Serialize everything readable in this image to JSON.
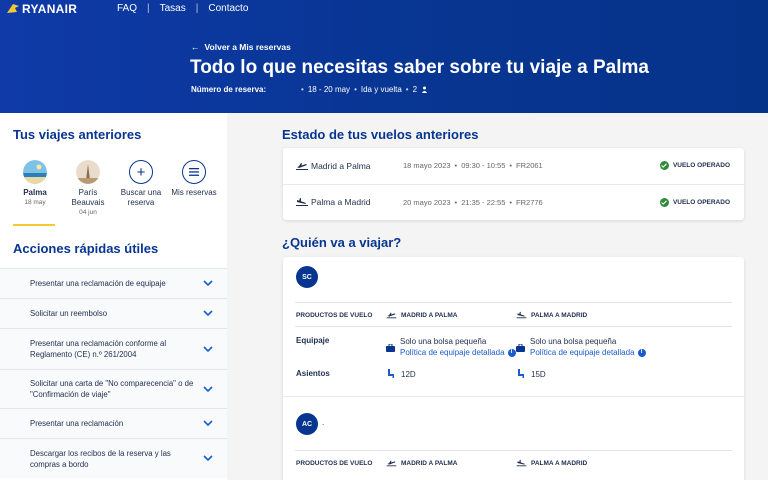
{
  "brand": {
    "name": "RYANAIR",
    "accent": "#073590",
    "yellow": "#f1c933"
  },
  "topnav": {
    "faq": "FAQ",
    "rates": "Tasas",
    "contact": "Contacto"
  },
  "hero": {
    "back_link": "Volver a Mis reservas",
    "title": "Todo lo que necesitas saber sobre tu viaje a Palma",
    "booking_label": "Número de reserva:",
    "dates": "18 - 20 may",
    "trip_type": "Ida y vuelta",
    "passengers": "2"
  },
  "sidebar": {
    "past_trips_title": "Tus viajes anteriores",
    "trips": [
      {
        "name": "Palma",
        "date": "18 may"
      },
      {
        "name": "París Beauvais",
        "date": "04 jun"
      }
    ],
    "search_trip": "Buscar una reserva",
    "my_bookings": "Mis reservas",
    "quick_actions_title": "Acciones rápidas útiles",
    "actions": [
      "Presentar una reclamación de equipaje",
      "Solicitar un reembolso",
      "Presentar una reclamación conforme al Reglamento (CE) n.º 261/2004",
      "Solicitar una carta de \"No comparecencia\" o de \"Confirmación de viaje\"",
      "Presentar una reclamación",
      "Descargar los recibos de la reserva y las compras a bordo"
    ]
  },
  "flights_section": {
    "title": "Estado de tus vuelos anteriores",
    "flights": [
      {
        "route": "Madrid a Palma",
        "date": "18 mayo 2023",
        "time": "09:30 - 10:55",
        "code": "FR2061",
        "status": "VUELO OPERADO"
      },
      {
        "route": "Palma a Madrid",
        "date": "20 mayo 2023",
        "time": "21:35 - 22:55",
        "code": "FR2776",
        "status": "VUELO OPERADO"
      }
    ]
  },
  "passengers_section": {
    "title": "¿Quién va a viajar?",
    "products_header": "PRODUCTOS DE VUELO",
    "outbound_header": "MADRID A PALMA",
    "return_header": "PALMA A MADRID",
    "baggage_label": "Equipaje",
    "seats_label": "Asientos",
    "passengers": [
      {
        "initials": "SC",
        "outbound_bag": "Solo una bolsa pequeña",
        "outbound_policy": "Política de equipaje detallada",
        "return_bag": "Solo una bolsa pequeña",
        "return_policy": "Política de equipaje detallada",
        "outbound_seat": "12D",
        "return_seat": "15D"
      },
      {
        "initials": "AC"
      }
    ]
  }
}
